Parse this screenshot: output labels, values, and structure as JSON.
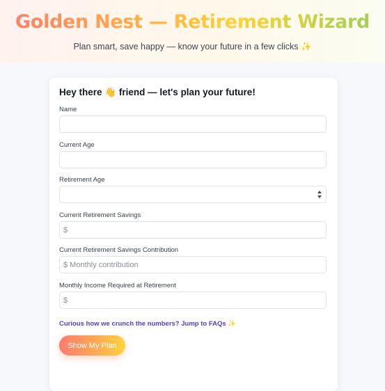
{
  "hero": {
    "title": "Golden Nest — Retirement Wizard",
    "subtitle": "Plan smart, save happy — know your future in a few clicks",
    "subtitle_sparkle": "✨"
  },
  "form": {
    "heading": "Hey there 👋 friend — let's plan your future!",
    "fields": [
      {
        "label": "Name",
        "value": "",
        "placeholder": ""
      },
      {
        "label": "Current Age",
        "value": "",
        "placeholder": ""
      },
      {
        "label": "Retirement Age",
        "value": "",
        "placeholder": ""
      },
      {
        "label": "Current Retirement Savings",
        "value": "",
        "placeholder": "$"
      },
      {
        "label": "Current Retirement Savings Contribution",
        "value": "",
        "placeholder": "$ Monthly contribution"
      },
      {
        "label": "Monthly Income Required at Retirement",
        "value": "",
        "placeholder": "$"
      }
    ],
    "faq_link": "Curious how we crunch the numbers? Jump to FAQs",
    "faq_sparkle": "✨",
    "submit_label": "Show My Plan"
  },
  "colors": {
    "accent_link": "#4f3fd6",
    "button_gradient_start": "#ff7b6e",
    "button_gradient_end": "#ffd33e",
    "title_gradient_start": "#ff7a6b",
    "title_gradient_end": "#95d15a"
  },
  "icons": {
    "age_stepper": "number-stepper-icon",
    "sparkle": "sparkle-icon"
  }
}
